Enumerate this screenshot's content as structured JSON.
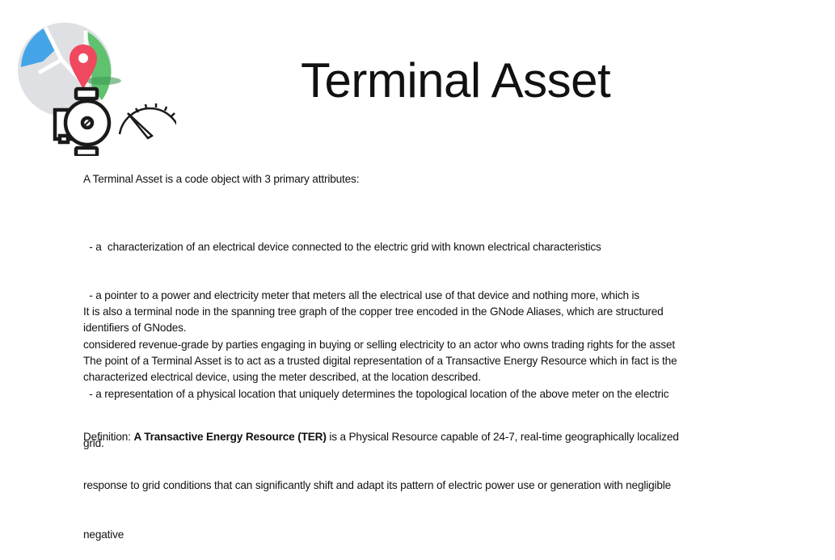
{
  "title": "Terminal Asset",
  "icon": "map-pin-pump-gauge-icon",
  "colors": {
    "map_gray": "#dfe0e4",
    "map_blue": "#45a4e8",
    "map_green": "#5fc26e",
    "pin_red": "#f0485e",
    "ink": "#1a1a1a"
  },
  "intro": "A Terminal Asset is a code object with 3 primary attributes:",
  "attributes_lines": [
    "  - a  characterization of an electrical device connected to the electric grid with known electrical characteristics",
    "  - a pointer to a power and electricity meter that meters all the electrical use of that device and nothing more, which is",
    "considered revenue-grade by parties engaging in buying or selling electricity to an actor who owns trading rights for the asset",
    "  - a representation of a physical location that uniquely determines the topological location of the above meter on the electric",
    "grid."
  ],
  "terminal_node_lines": [
    "It is also a terminal node in the spanning tree graph of the copper tree encoded in the GNode Aliases, which are structured",
    "identifiers of GNodes."
  ],
  "point_lines": [
    "The point of a Terminal Asset is to act as a trusted digital representation of a Transactive Energy Resource which in fact is the",
    "characterized electrical device, using the meter described, at the location described."
  ],
  "definition": {
    "label": "Definition: ",
    "term": "A Transactive Energy Resource (TER)",
    "line1_rest": " is a Physical Resource capable of 24-7, real-time geographically localized",
    "line2": "response to grid conditions that can significantly shift and adapt its pattern of electric power use or generation with negligible",
    "line3": "negative"
  }
}
